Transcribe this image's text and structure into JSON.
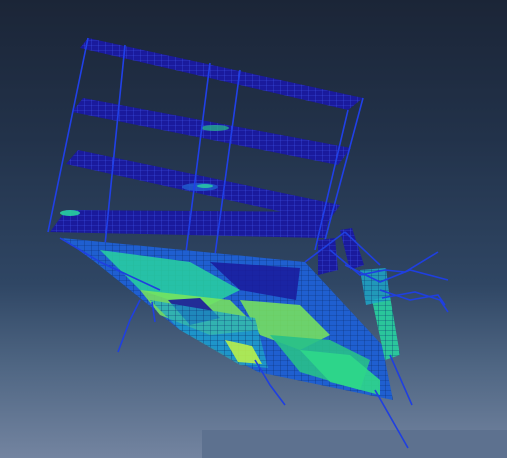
{
  "viewport": {
    "background_top": "#1b2537",
    "background_bottom": "#7384a0"
  },
  "model": {
    "frame_color": "#1f3fe0",
    "slab_base_color": "#1a1a9c",
    "mesh_line_color": "#2a3ad8",
    "contour_colors": [
      "#1a1a9c",
      "#1f5fd0",
      "#1fa7c8",
      "#28d2a0",
      "#7ae65a",
      "#b9f04a"
    ],
    "floors": 4
  }
}
